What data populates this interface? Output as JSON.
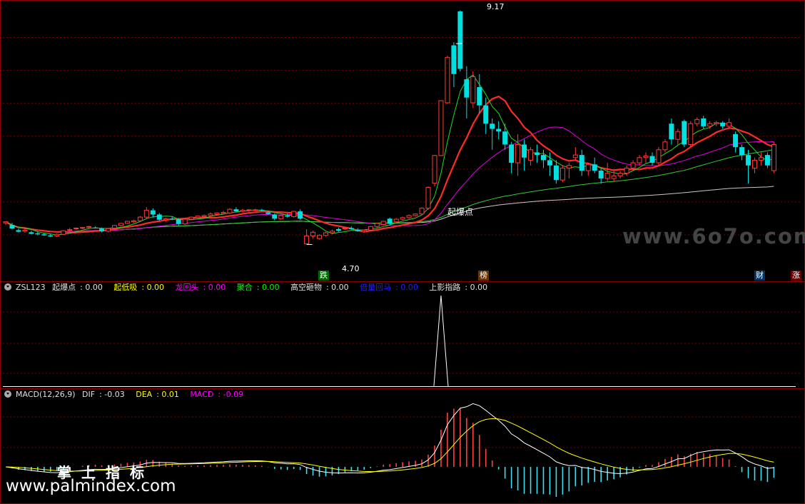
{
  "chart_data": [
    {
      "type": "candlestick",
      "panel": "price",
      "ylim": [
        4.2,
        9.3
      ],
      "gridlines": [
        8.65,
        8.02,
        7.39,
        6.76,
        6.13,
        5.5,
        4.87
      ],
      "candles": [
        {
          "o": 5.1,
          "h": 5.13,
          "l": 5.06,
          "c": 5.12
        },
        {
          "o": 5.06,
          "h": 5.1,
          "l": 4.98,
          "c": 4.99
        },
        {
          "o": 4.96,
          "h": 4.99,
          "l": 4.92,
          "c": 4.93
        },
        {
          "o": 4.94,
          "h": 4.99,
          "l": 4.91,
          "c": 4.96
        },
        {
          "o": 4.92,
          "h": 4.95,
          "l": 4.88,
          "c": 4.89
        },
        {
          "o": 4.9,
          "h": 4.93,
          "l": 4.86,
          "c": 4.88
        },
        {
          "o": 4.88,
          "h": 4.91,
          "l": 4.85,
          "c": 4.86
        },
        {
          "o": 4.86,
          "h": 4.89,
          "l": 4.83,
          "c": 4.84
        },
        {
          "o": 4.85,
          "h": 4.9,
          "l": 4.83,
          "c": 4.88
        },
        {
          "o": 4.88,
          "h": 4.96,
          "l": 4.87,
          "c": 4.95
        },
        {
          "o": 4.96,
          "h": 5.0,
          "l": 4.94,
          "c": 4.97
        },
        {
          "o": 4.99,
          "h": 5.01,
          "l": 4.97,
          "c": 5.0
        },
        {
          "o": 5.0,
          "h": 5.02,
          "l": 4.98,
          "c": 5.01
        },
        {
          "o": 5.02,
          "h": 5.04,
          "l": 5.0,
          "c": 5.03
        },
        {
          "o": 5.01,
          "h": 5.03,
          "l": 4.99,
          "c": 5.0
        },
        {
          "o": 4.99,
          "h": 5.01,
          "l": 4.92,
          "c": 4.94
        },
        {
          "o": 4.94,
          "h": 5.0,
          "l": 4.92,
          "c": 4.99
        },
        {
          "o": 5.0,
          "h": 5.06,
          "l": 4.98,
          "c": 5.05
        },
        {
          "o": 5.05,
          "h": 5.1,
          "l": 5.03,
          "c": 5.09
        },
        {
          "o": 5.09,
          "h": 5.14,
          "l": 5.08,
          "c": 5.13
        },
        {
          "o": 5.12,
          "h": 5.16,
          "l": 5.1,
          "c": 5.14
        },
        {
          "o": 5.14,
          "h": 5.23,
          "l": 5.12,
          "c": 5.21
        },
        {
          "o": 5.21,
          "h": 5.4,
          "l": 5.19,
          "c": 5.34
        },
        {
          "o": 5.34,
          "h": 5.38,
          "l": 5.2,
          "c": 5.26
        },
        {
          "o": 5.26,
          "h": 5.29,
          "l": 5.14,
          "c": 5.16
        },
        {
          "o": 5.16,
          "h": 5.2,
          "l": 5.12,
          "c": 5.18
        },
        {
          "o": 5.18,
          "h": 5.22,
          "l": 5.15,
          "c": 5.17
        },
        {
          "o": 5.17,
          "h": 5.19,
          "l": 5.05,
          "c": 5.08
        },
        {
          "o": 5.08,
          "h": 5.19,
          "l": 5.06,
          "c": 5.17
        },
        {
          "o": 5.17,
          "h": 5.22,
          "l": 5.15,
          "c": 5.21
        },
        {
          "o": 5.2,
          "h": 5.24,
          "l": 5.18,
          "c": 5.23
        },
        {
          "o": 5.22,
          "h": 5.26,
          "l": 5.2,
          "c": 5.24
        },
        {
          "o": 5.24,
          "h": 5.3,
          "l": 5.22,
          "c": 5.27
        },
        {
          "o": 5.26,
          "h": 5.3,
          "l": 5.24,
          "c": 5.29
        },
        {
          "o": 5.28,
          "h": 5.33,
          "l": 5.26,
          "c": 5.3
        },
        {
          "o": 5.29,
          "h": 5.38,
          "l": 5.27,
          "c": 5.36
        },
        {
          "o": 5.36,
          "h": 5.4,
          "l": 5.3,
          "c": 5.32
        },
        {
          "o": 5.32,
          "h": 5.37,
          "l": 5.3,
          "c": 5.34
        },
        {
          "o": 5.34,
          "h": 5.36,
          "l": 5.31,
          "c": 5.35
        },
        {
          "o": 5.35,
          "h": 5.37,
          "l": 5.33,
          "c": 5.35
        },
        {
          "o": 5.35,
          "h": 5.37,
          "l": 5.32,
          "c": 5.34
        },
        {
          "o": 5.3,
          "h": 5.33,
          "l": 5.25,
          "c": 5.27
        },
        {
          "o": 5.26,
          "h": 5.28,
          "l": 5.15,
          "c": 5.18
        },
        {
          "o": 5.18,
          "h": 5.26,
          "l": 5.16,
          "c": 5.24
        },
        {
          "o": 5.24,
          "h": 5.28,
          "l": 5.2,
          "c": 5.22
        },
        {
          "o": 5.22,
          "h": 5.33,
          "l": 5.2,
          "c": 5.32
        },
        {
          "o": 5.32,
          "h": 5.36,
          "l": 5.16,
          "c": 5.18
        },
        {
          "o": 4.7,
          "h": 4.98,
          "l": 4.7,
          "c": 4.85
        },
        {
          "o": 4.85,
          "h": 4.95,
          "l": 4.8,
          "c": 4.92
        },
        {
          "o": 4.8,
          "h": 4.88,
          "l": 4.78,
          "c": 4.86
        },
        {
          "o": 4.86,
          "h": 4.93,
          "l": 4.84,
          "c": 4.91
        },
        {
          "o": 4.91,
          "h": 4.97,
          "l": 4.88,
          "c": 4.94
        },
        {
          "o": 4.98,
          "h": 5.01,
          "l": 4.93,
          "c": 4.95
        },
        {
          "o": 4.99,
          "h": 5.02,
          "l": 4.96,
          "c": 5.0
        },
        {
          "o": 5.0,
          "h": 5.03,
          "l": 4.97,
          "c": 4.98
        },
        {
          "o": 4.97,
          "h": 5.0,
          "l": 4.93,
          "c": 4.94
        },
        {
          "o": 4.93,
          "h": 4.97,
          "l": 4.91,
          "c": 4.96
        },
        {
          "o": 4.96,
          "h": 5.04,
          "l": 4.94,
          "c": 5.03
        },
        {
          "o": 5.03,
          "h": 5.1,
          "l": 5.01,
          "c": 5.09
        },
        {
          "o": 5.07,
          "h": 5.14,
          "l": 5.05,
          "c": 5.13
        },
        {
          "o": 5.18,
          "h": 5.2,
          "l": 5.06,
          "c": 5.08
        },
        {
          "o": 5.12,
          "h": 5.19,
          "l": 5.1,
          "c": 5.17
        },
        {
          "o": 5.17,
          "h": 5.22,
          "l": 5.15,
          "c": 5.2
        },
        {
          "o": 5.2,
          "h": 5.26,
          "l": 5.18,
          "c": 5.24
        },
        {
          "o": 5.24,
          "h": 5.28,
          "l": 5.22,
          "c": 5.27
        },
        {
          "o": 5.27,
          "h": 5.4,
          "l": 5.25,
          "c": 5.38
        },
        {
          "o": 5.38,
          "h": 5.8,
          "l": 5.35,
          "c": 5.78
        },
        {
          "o": 5.86,
          "h": 6.4,
          "l": 5.8,
          "c": 6.39
        },
        {
          "o": 6.39,
          "h": 7.45,
          "l": 6.38,
          "c": 7.44
        },
        {
          "o": 7.4,
          "h": 8.3,
          "l": 7.38,
          "c": 8.27
        },
        {
          "o": 8.5,
          "h": 8.56,
          "l": 7.7,
          "c": 7.95
        },
        {
          "o": 9.15,
          "h": 9.17,
          "l": 8.0,
          "c": 8.05
        },
        {
          "o": 7.85,
          "h": 8.1,
          "l": 7.1,
          "c": 7.5
        },
        {
          "o": 7.4,
          "h": 8.0,
          "l": 7.3,
          "c": 7.9
        },
        {
          "o": 7.7,
          "h": 7.95,
          "l": 7.2,
          "c": 7.35
        },
        {
          "o": 7.35,
          "h": 7.5,
          "l": 6.8,
          "c": 7.0
        },
        {
          "o": 7.0,
          "h": 7.1,
          "l": 6.5,
          "c": 6.9
        },
        {
          "o": 6.9,
          "h": 7.05,
          "l": 6.7,
          "c": 6.85
        },
        {
          "o": 6.85,
          "h": 7.0,
          "l": 6.5,
          "c": 6.6
        },
        {
          "o": 6.6,
          "h": 6.65,
          "l": 6.05,
          "c": 6.25
        },
        {
          "o": 6.25,
          "h": 6.8,
          "l": 6.0,
          "c": 6.6
        },
        {
          "o": 6.6,
          "h": 6.7,
          "l": 6.1,
          "c": 6.35
        },
        {
          "o": 6.3,
          "h": 6.55,
          "l": 6.2,
          "c": 6.5
        },
        {
          "o": 6.45,
          "h": 6.6,
          "l": 6.25,
          "c": 6.4
        },
        {
          "o": 6.4,
          "h": 6.5,
          "l": 6.15,
          "c": 6.3
        },
        {
          "o": 6.3,
          "h": 6.45,
          "l": 6.0,
          "c": 6.2
        },
        {
          "o": 6.2,
          "h": 6.3,
          "l": 5.85,
          "c": 5.92
        },
        {
          "o": 5.92,
          "h": 6.2,
          "l": 5.88,
          "c": 6.15
        },
        {
          "o": 6.15,
          "h": 6.25,
          "l": 5.95,
          "c": 6.2
        },
        {
          "o": 6.35,
          "h": 6.55,
          "l": 6.3,
          "c": 6.4
        },
        {
          "o": 6.4,
          "h": 6.5,
          "l": 6.0,
          "c": 6.1
        },
        {
          "o": 6.1,
          "h": 6.25,
          "l": 6.0,
          "c": 6.22
        },
        {
          "o": 6.22,
          "h": 6.35,
          "l": 6.05,
          "c": 6.1
        },
        {
          "o": 6.1,
          "h": 6.15,
          "l": 5.85,
          "c": 5.95
        },
        {
          "o": 5.95,
          "h": 6.25,
          "l": 5.9,
          "c": 6.05
        },
        {
          "o": 5.95,
          "h": 6.1,
          "l": 5.88,
          "c": 6.0
        },
        {
          "o": 6.0,
          "h": 6.1,
          "l": 5.95,
          "c": 6.05
        },
        {
          "o": 6.05,
          "h": 6.2,
          "l": 6.0,
          "c": 6.15
        },
        {
          "o": 6.15,
          "h": 6.3,
          "l": 6.1,
          "c": 6.25
        },
        {
          "o": 6.25,
          "h": 6.4,
          "l": 6.2,
          "c": 6.35
        },
        {
          "o": 6.35,
          "h": 6.45,
          "l": 6.25,
          "c": 6.38
        },
        {
          "o": 6.38,
          "h": 6.45,
          "l": 6.2,
          "c": 6.25
        },
        {
          "o": 6.25,
          "h": 6.55,
          "l": 6.2,
          "c": 6.5
        },
        {
          "o": 6.5,
          "h": 6.7,
          "l": 6.45,
          "c": 6.65
        },
        {
          "o": 7.0,
          "h": 7.1,
          "l": 6.6,
          "c": 6.7
        },
        {
          "o": 6.7,
          "h": 6.9,
          "l": 6.6,
          "c": 6.85
        },
        {
          "o": 7.05,
          "h": 7.08,
          "l": 6.55,
          "c": 6.6
        },
        {
          "o": 6.6,
          "h": 7.05,
          "l": 6.55,
          "c": 7.0
        },
        {
          "o": 7.0,
          "h": 7.12,
          "l": 6.95,
          "c": 7.08
        },
        {
          "o": 7.1,
          "h": 7.15,
          "l": 6.9,
          "c": 6.95
        },
        {
          "o": 6.95,
          "h": 7.05,
          "l": 6.9,
          "c": 7.0
        },
        {
          "o": 7.0,
          "h": 7.05,
          "l": 6.95,
          "c": 7.02
        },
        {
          "o": 7.02,
          "h": 7.05,
          "l": 6.9,
          "c": 6.95
        },
        {
          "o": 6.95,
          "h": 7.1,
          "l": 6.9,
          "c": 7.02
        },
        {
          "o": 6.8,
          "h": 6.85,
          "l": 6.45,
          "c": 6.55
        },
        {
          "o": 6.55,
          "h": 6.6,
          "l": 6.3,
          "c": 6.4
        },
        {
          "o": 6.4,
          "h": 6.5,
          "l": 5.85,
          "c": 6.2
        },
        {
          "o": 6.15,
          "h": 6.35,
          "l": 6.05,
          "c": 6.3
        },
        {
          "o": 6.3,
          "h": 6.45,
          "l": 6.2,
          "c": 6.35
        },
        {
          "o": 6.4,
          "h": 6.45,
          "l": 6.15,
          "c": 6.2
        },
        {
          "o": 6.1,
          "h": 6.65,
          "l": 6.05,
          "c": 6.6
        }
      ],
      "annotations": {
        "high": {
          "value": "9.17",
          "index": 70
        },
        "low": {
          "value": "4.70",
          "index": 47
        },
        "signal": {
          "text": "起爆点",
          "index": 67
        }
      },
      "badges": [
        {
          "text": "跌",
          "index": 47,
          "bg": "#006600"
        },
        {
          "text": "榜",
          "index": 71,
          "bg": "#663300"
        },
        {
          "text": "财",
          "index": 112,
          "bg": "#003366"
        },
        {
          "text": "涨",
          "index": 118,
          "bg": "#660000"
        }
      ],
      "colors": {
        "up": "#ff3a3a",
        "down": "#00e0e0",
        "ma5": "#20dd20",
        "ma10": "#ff2a2a",
        "ma20": "#e000e0",
        "ma60": "#30cc30",
        "ma120": "#c8c8c8"
      }
    },
    {
      "type": "line",
      "panel": "indicator",
      "title": "ZSL123",
      "legend": [
        {
          "name": "起爆点",
          "value": "0.00",
          "color": "#e0e0e0"
        },
        {
          "name": "起低吸",
          "value": "0.00",
          "color": "#ffff00"
        },
        {
          "name": "龙回头",
          "value": "0.00",
          "color": "#ff00ff"
        },
        {
          "name": "聚合",
          "value": "0.00",
          "color": "#00ff00"
        },
        {
          "name": "高空砸物",
          "value": "0.00",
          "color": "#e0e0e0"
        },
        {
          "name": "倍量回马",
          "value": "0.00",
          "color": "#2020ff"
        },
        {
          "name": "上影指路",
          "value": "0.00",
          "color": "#e0e0e0"
        }
      ],
      "spike_index": 68,
      "ylim": [
        0,
        1
      ]
    },
    {
      "type": "line",
      "panel": "macd",
      "title": "MACD(12,26,9)",
      "legend": [
        {
          "name": "DIF",
          "value": "-0.03",
          "color": "#e0e0e0"
        },
        {
          "name": "DEA",
          "value": "0.01",
          "color": "#ffff00"
        },
        {
          "name": "MACD",
          "value": "-0.09",
          "color": "#ff00ff"
        }
      ],
      "ylim": [
        -0.36,
        0.72
      ]
    }
  ],
  "watermarks": {
    "site_cn": "掌上指标",
    "site_url": "www.palmindex.com",
    "site_logo": "www.6o7o.com"
  }
}
